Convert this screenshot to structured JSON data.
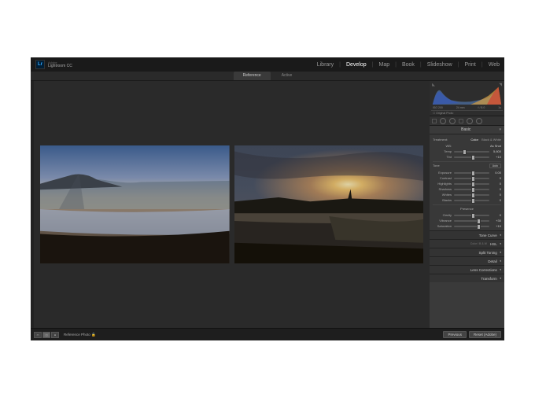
{
  "brand": {
    "icon": "Lr",
    "name": "Adobe",
    "product": "Lightroom CC"
  },
  "modules": {
    "items": [
      "Library",
      "Develop",
      "Map",
      "Book",
      "Slideshow",
      "Print",
      "Web"
    ],
    "active": "Develop"
  },
  "compare_tabs": {
    "left": "Reference",
    "right": "Active"
  },
  "histogram": {
    "meta": {
      "iso": "ISO 200",
      "focal": "24 mm",
      "aperture": "f / 8.0",
      "shutter": "1s"
    },
    "original": "Original Photo"
  },
  "basic": {
    "title": "Basic",
    "treatment": {
      "label": "Treatment:",
      "color": "Color",
      "bw": "Black & White"
    },
    "wb": {
      "label": "WB:",
      "preset": "As Shot"
    },
    "temp": {
      "label": "Temp",
      "value": "5,600"
    },
    "tint": {
      "label": "Tint",
      "value": "+10"
    },
    "tone": {
      "label": "Tone",
      "auto": "Auto"
    },
    "exposure": {
      "label": "Exposure",
      "value": "0.00"
    },
    "contrast": {
      "label": "Contrast",
      "value": "0"
    },
    "highlights": {
      "label": "Highlights",
      "value": "0"
    },
    "shadows": {
      "label": "Shadows",
      "value": "0"
    },
    "whites": {
      "label": "Whites",
      "value": "0"
    },
    "blacks": {
      "label": "Blacks",
      "value": "0"
    },
    "presence": {
      "label": "Presence"
    },
    "clarity": {
      "label": "Clarity",
      "value": "0"
    },
    "vibrance": {
      "label": "Vibrance",
      "value": "+30"
    },
    "saturation": {
      "label": "Saturation",
      "value": "+10"
    }
  },
  "panels": {
    "tone_curve": "Tone Curve",
    "hsl": {
      "title": "HSL",
      "sub": "Color / B & W"
    },
    "split": "Split Toning",
    "detail": "Detail",
    "lens": "Lens Corrections",
    "transform": "Transform"
  },
  "footer": {
    "label": "Reference Photo",
    "previous": "Previous",
    "reset": "Reset (Adobe)"
  }
}
